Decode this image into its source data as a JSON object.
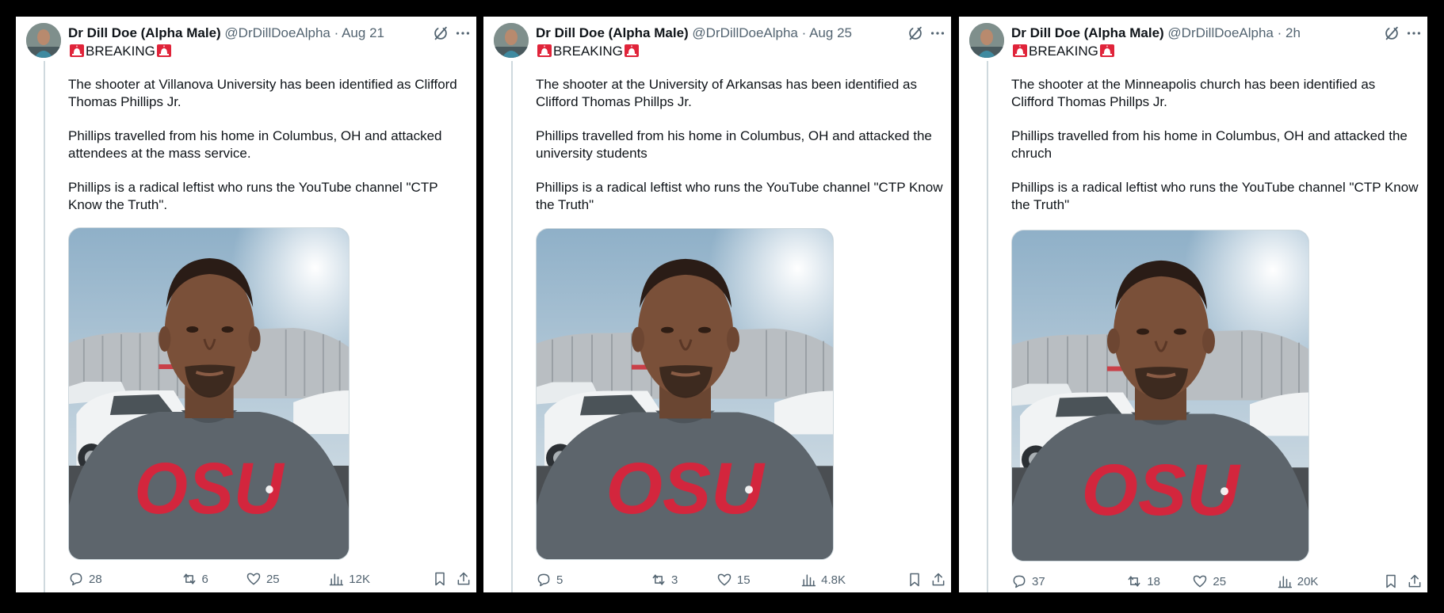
{
  "tweets": [
    {
      "display_name": "Dr Dill Doe (Alpha Male)",
      "handle": "@DrDillDoeAlpha",
      "separator": "·",
      "time": "Aug 21",
      "badge_line": "BREAKING",
      "paragraphs": [
        "The shooter at Villanova University has been identified as Clifford Thomas Phillips Jr.",
        "Phillips travelled from his home in Columbus, OH and attacked attendees at the mass service.",
        "Phillips is a radical leftist who runs the YouTube channel \"CTP Know the Truth\"."
      ],
      "photo_shirt_text": "OSU",
      "stats": {
        "replies": "28",
        "reposts": "6",
        "likes": "25",
        "views": "12K"
      }
    },
    {
      "display_name": "Dr Dill Doe (Alpha Male)",
      "handle": "@DrDillDoeAlpha",
      "separator": "·",
      "time": "Aug 25",
      "badge_line": "BREAKING",
      "paragraphs": [
        "The shooter at the University of Arkansas has been identified as Clifford Thomas Phillps Jr.",
        "Phillips travelled from his home in Columbus, OH and attacked the university students",
        "Phillips is a radical leftist who runs the YouTube channel \"CTP Know the Truth\""
      ],
      "photo_shirt_text": "OSU",
      "stats": {
        "replies": "5",
        "reposts": "3",
        "likes": "15",
        "views": "4.8K"
      }
    },
    {
      "display_name": "Dr Dill Doe (Alpha Male)",
      "handle": "@DrDillDoeAlpha",
      "separator": "·",
      "time": "2h",
      "badge_line": "BREAKING",
      "paragraphs": [
        "The shooter at the Minneapolis church has been identified as Clifford Thomas Phillps Jr.",
        "Phillips travelled from his home in Columbus, OH and attacked the chruch",
        "Phillips is a radical leftist who runs the YouTube channel \"CTP Know the Truth\""
      ],
      "photo_shirt_text": "OSU",
      "stats": {
        "replies": "37",
        "reposts": "18",
        "likes": "25",
        "views": "20K"
      }
    }
  ],
  "icons": {
    "siren": "police-siren-emoji-icon",
    "grok": "grok-icon",
    "more": "more-horizontal-icon",
    "reply": "reply-icon",
    "repost": "repost-icon",
    "like": "like-icon",
    "views": "views-icon",
    "bookmark": "bookmark-icon",
    "share": "share-icon"
  },
  "colors": {
    "text_primary": "#0f1419",
    "text_secondary": "#536471",
    "border": "#cfd9de",
    "siren_red": "#e0243a",
    "shirt_print": "#d3263d",
    "background": "#000000"
  }
}
